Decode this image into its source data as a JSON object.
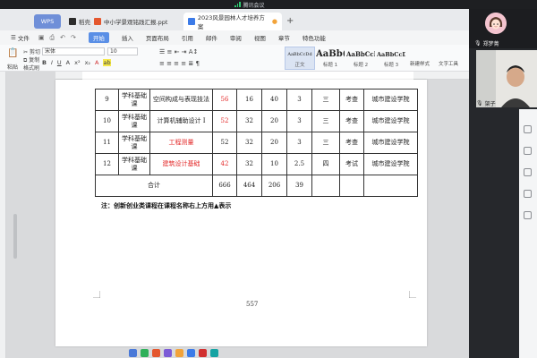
{
  "meeting": {
    "title": "腾讯会议"
  },
  "tabs": [
    {
      "label": "WPS"
    },
    {
      "label": "稻壳"
    },
    {
      "label": "中小学景观铭践汇报.ppt"
    },
    {
      "label": "2023风景园林人才培养方案"
    }
  ],
  "menu": {
    "file": "文件",
    "items": [
      "开始",
      "插入",
      "页面布局",
      "引用",
      "邮件",
      "审阅",
      "视图",
      "章节",
      "特色功能"
    ]
  },
  "ribbon": {
    "paste": "粘贴",
    "cut": "剪切",
    "copy": "复制",
    "format_painter": "格式刷",
    "font": "宋体",
    "size": "10",
    "styles": [
      {
        "sample": "AaBbCcDd",
        "name": "正文"
      },
      {
        "sample": "AaBb(",
        "name": "标题 1"
      },
      {
        "sample": "AaBbCcI",
        "name": "标题 2"
      },
      {
        "sample": "AaBbCcD",
        "name": "标题 3"
      }
    ],
    "new_style": "新建样式",
    "text_tools": "文字工具"
  },
  "table": {
    "rows": [
      {
        "no": "9",
        "type": "学科基础课",
        "course": "空间构成与表现技法",
        "red": false,
        "credit_red": true,
        "c1": "56",
        "c2": "16",
        "c3": "40",
        "c4": "3",
        "term": "三",
        "exam": "考查",
        "dept": "城市建设学院"
      },
      {
        "no": "10",
        "type": "学科基础课",
        "course": "计算机辅助设计 I",
        "red": false,
        "credit_red": true,
        "c1": "52",
        "c2": "32",
        "c3": "20",
        "c4": "3",
        "term": "三",
        "exam": "考查",
        "dept": "城市建设学院"
      },
      {
        "no": "11",
        "type": "学科基础课",
        "course": "工程测量",
        "red": true,
        "credit_red": false,
        "c1": "52",
        "c2": "32",
        "c3": "20",
        "c4": "3",
        "term": "三",
        "exam": "考查",
        "dept": "城市建设学院"
      },
      {
        "no": "12",
        "type": "学科基础课",
        "course": "建筑设计基础",
        "red": true,
        "credit_red": true,
        "c1": "42",
        "c2": "32",
        "c3": "10",
        "c4": "2.5",
        "term": "四",
        "exam": "考试",
        "dept": "城市建设学院"
      }
    ],
    "total": {
      "label": "合计",
      "c1": "666",
      "c2": "464",
      "c3": "206",
      "c4": "39"
    }
  },
  "note": "注：创新创业类课程在课程名称右上方用▲表示",
  "page_number": "557",
  "participants": [
    {
      "name": "郑梦菁"
    },
    {
      "name": "架子"
    }
  ]
}
